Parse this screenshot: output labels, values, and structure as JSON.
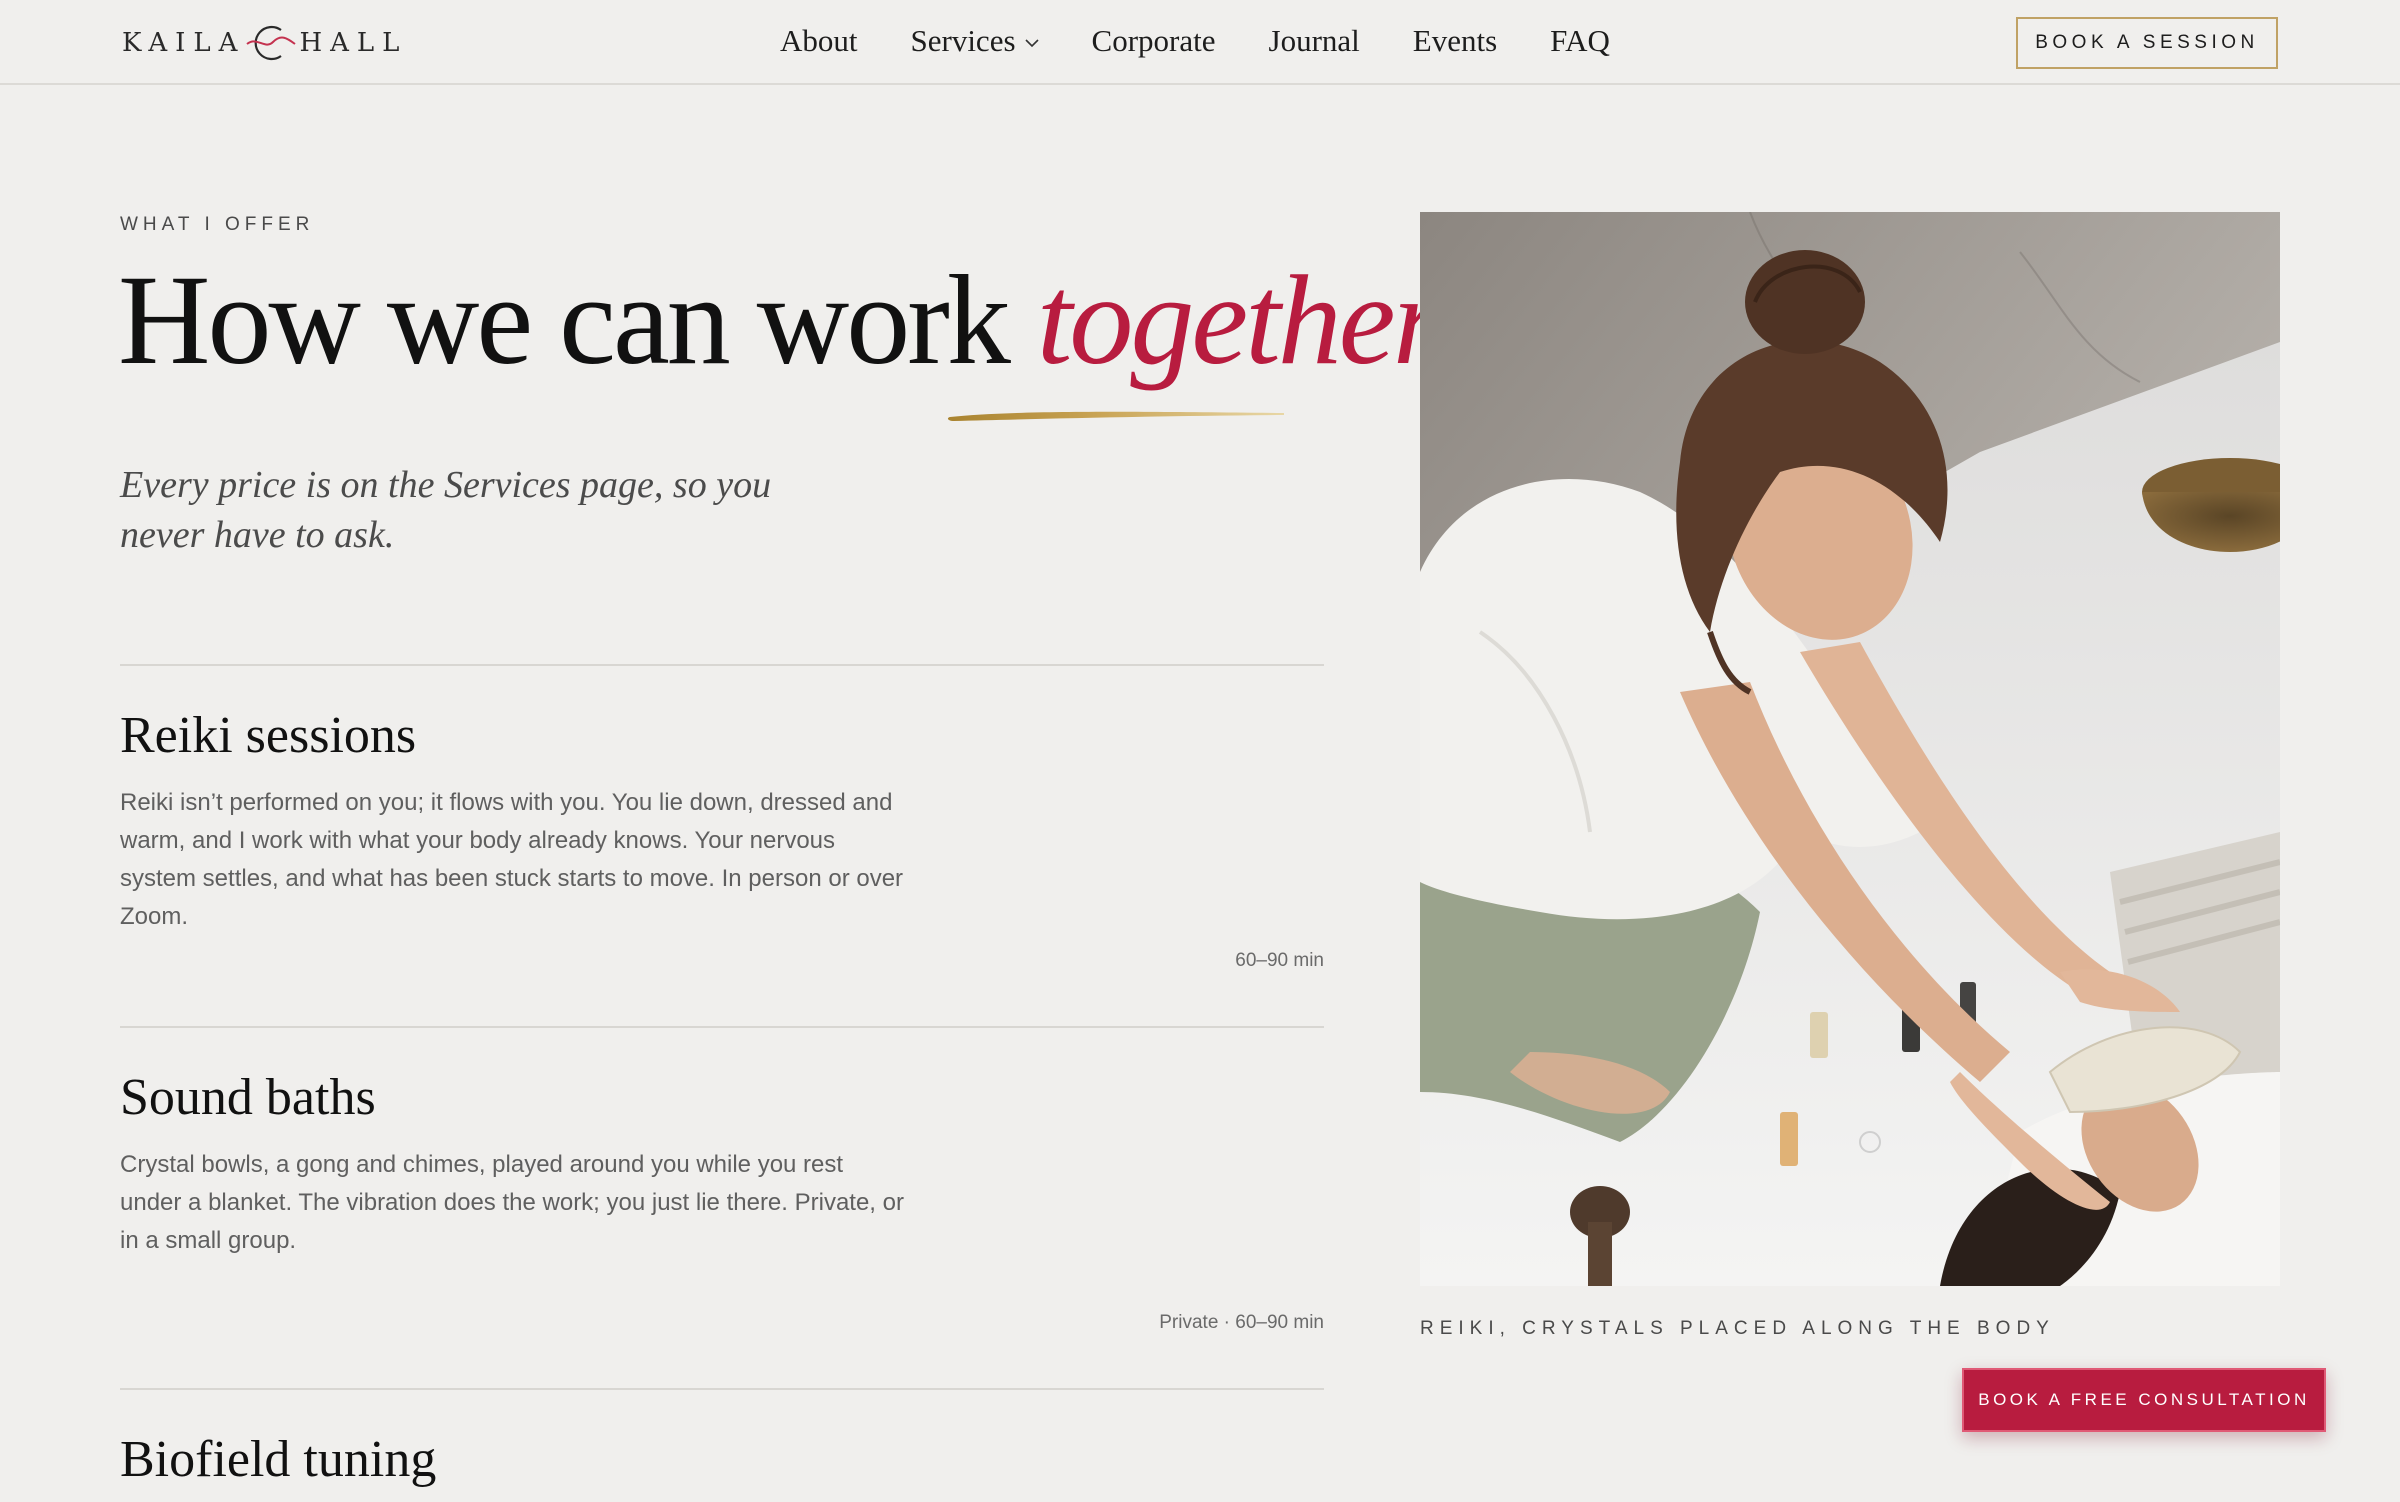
{
  "header": {
    "logo_left": "KAILA",
    "logo_right": "HALL",
    "nav": [
      {
        "label": "About"
      },
      {
        "label": "Services",
        "has_dropdown": true
      },
      {
        "label": "Corporate"
      },
      {
        "label": "Journal"
      },
      {
        "label": "Events"
      },
      {
        "label": "FAQ"
      }
    ],
    "cta": "BOOK A SESSION"
  },
  "hero": {
    "eyebrow": "WHAT I OFFER",
    "headline_main": "How we can work ",
    "headline_accent": "together",
    "subhead": "Every price is on the Services page, so you never have to ask."
  },
  "services": [
    {
      "title": "Reiki sessions",
      "description": "Reiki isn’t performed on you; it flows with you. You lie down, dressed and warm, and I work with what your body already knows. Your nervous system settles, and what has been stuck starts to move. In person or over Zoom.",
      "meta": "60–90 min"
    },
    {
      "title": "Sound baths",
      "description": "Crystal bowls, a gong and chimes, played around you while you rest under a blanket. The vibration does the work; you just lie there. Private, or in a small group.",
      "meta": "Private · 60–90 min"
    },
    {
      "title": "Biofield tuning",
      "description": "",
      "meta": ""
    }
  ],
  "image": {
    "caption": "REIKI, CRYSTALS PLACED ALONG THE BODY"
  },
  "floating_cta": "BOOK A FREE CONSULTATION",
  "colors": {
    "background": "#f0efed",
    "accent": "#b81c3f",
    "gold": "#c0a265",
    "text": "#111111"
  }
}
